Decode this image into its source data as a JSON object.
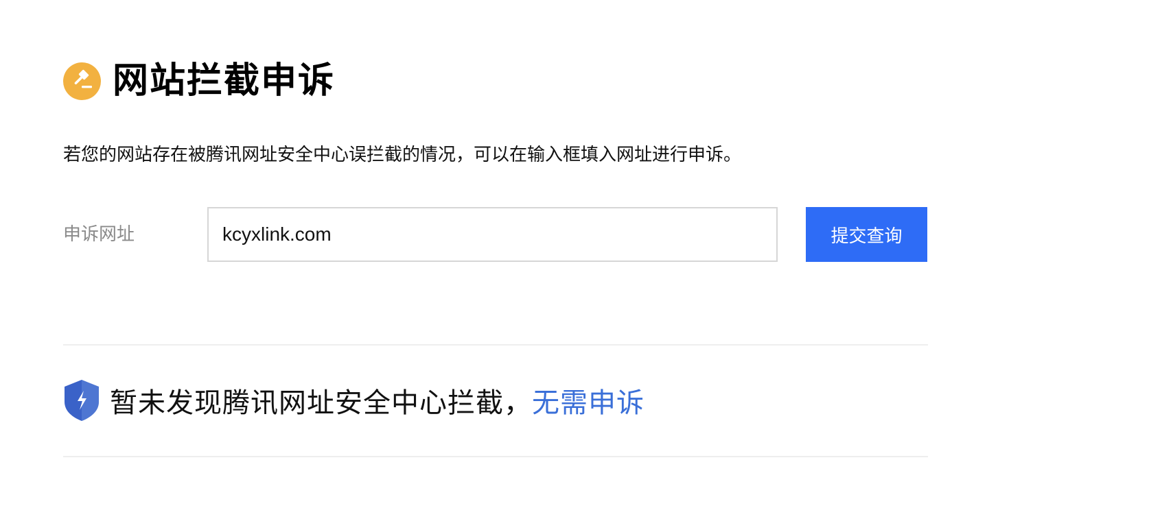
{
  "header": {
    "title": "网站拦截申诉",
    "icon": "gavel-icon",
    "icon_bg": "#f2b140"
  },
  "description": "若您的网站存在被腾讯网址安全中心误拦截的情况，可以在输入框填入网址进行申诉。",
  "form": {
    "label": "申诉网址",
    "url_value": "kcyxlink.com",
    "submit_label": "提交查询",
    "submit_color": "#2e6cf6"
  },
  "result": {
    "icon": "shield-icon",
    "icon_color": "#3a62c8",
    "message": "暂未发现腾讯网址安全中心拦截，",
    "link_text": "无需申诉",
    "link_color": "#3a6fd8"
  }
}
